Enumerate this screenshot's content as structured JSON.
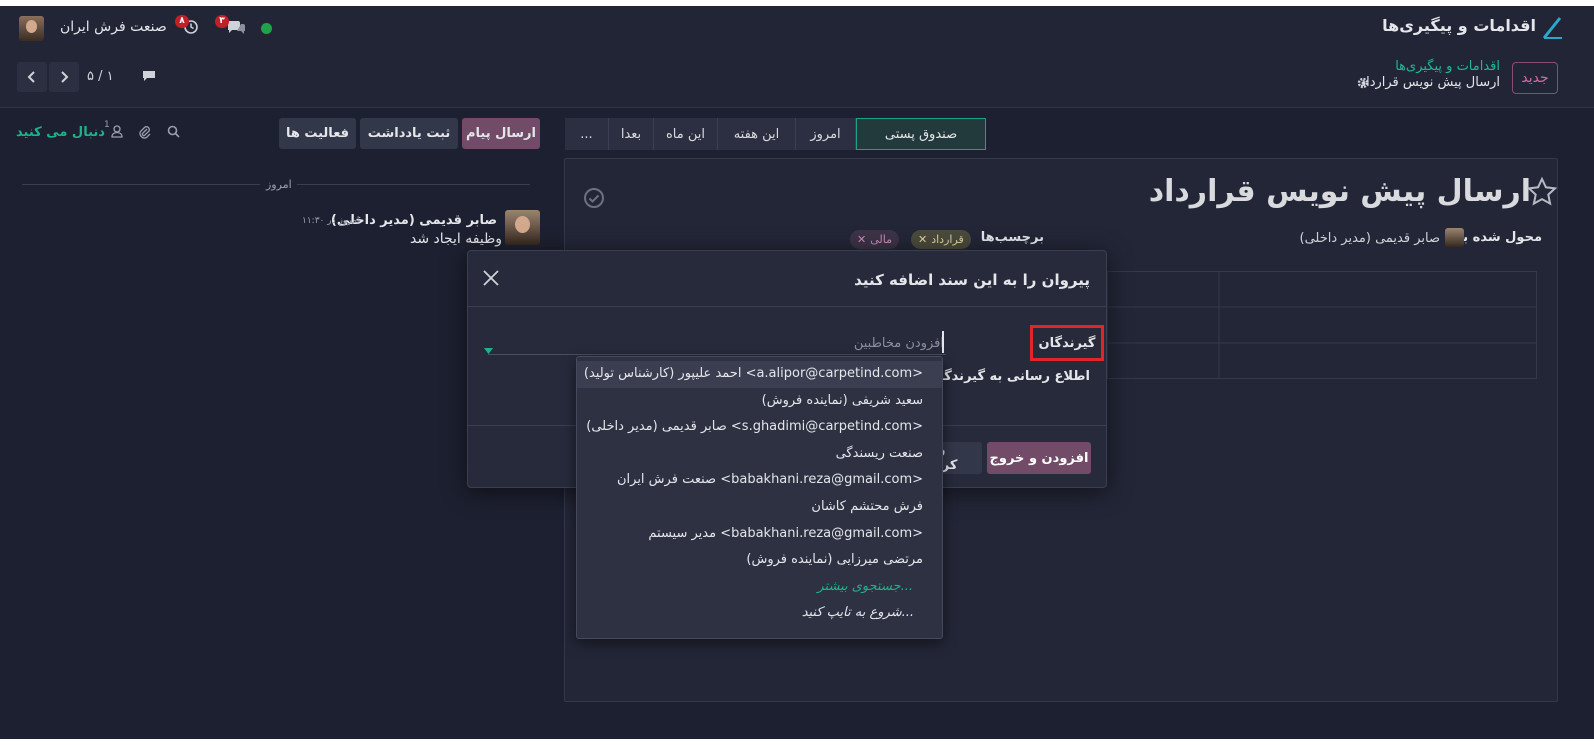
{
  "navbar": {
    "app_title": "اقدامات و پیگیری‌ها",
    "company": "صنعت فرش ایران",
    "activity_badge": "۸",
    "messages_badge": "۳"
  },
  "control_panel": {
    "new_button": "جدید",
    "breadcrumb_parent": "اقدامات و پیگیری‌ها",
    "breadcrumb_current": "ارسال پیش نویس قرارداد",
    "pager_value": "۵ / ۱"
  },
  "chatter": {
    "send_message": "ارسال پیام",
    "log_note": "ثبت یادداشت",
    "activities": "فعالیت ها",
    "follow": "دنبال می کنید",
    "follower_count": "1",
    "today_label": "امروز",
    "message": {
      "author": "صابر قدیمی (مدیر داخلی)",
      "date": "امروز در ۱۱:۳۰",
      "body": "وظیفه ایجاد شد"
    }
  },
  "statusbar": {
    "stages": [
      "...",
      "بعدا",
      "این ماه",
      "این هفته",
      "امروز",
      "صندوق پستی"
    ],
    "active": "صندوق پستی"
  },
  "form": {
    "title": "ارسال پیش نویس قرارداد",
    "assigned_label": "محول شده به",
    "assigned_value": "صابر قدیمی (مدیر داخلی)",
    "tags_label": "برچسب‌ها",
    "tags": [
      "قرارداد",
      "مالی"
    ]
  },
  "modal": {
    "title": "پیروان را به این سند اضافه کنید",
    "recipients_label": "گیرندگان",
    "recipients_placeholder": "افزودن مخاطبین",
    "notify_label": "اطلاع رسانی به گیرندگان",
    "add_close_button": "افزودن و خروج",
    "discard_button": "رها کردن"
  },
  "dropdown": {
    "items": [
      "احمد علیپور (کارشناس تولید) <a.alipor@carpetind.com>",
      "سعید شریفی (نماینده فروش)",
      "صابر قدیمی (مدیر داخلی) <s.ghadimi@carpetind.com>",
      "صنعت ریسندگی",
      "صنعت فرش ایران <babakhani.reza@gmail.com>",
      "فرش محتشم کاشان",
      "مدیر سیستم <babakhani.reza@gmail.com>",
      "مرتضی میرزایی (نماینده فروش)"
    ],
    "search_more": "جستجوی بیشتر...",
    "start_typing": "شروع به تایپ کنید..."
  },
  "colors": {
    "background": "#1d2030",
    "primary": "#714b67",
    "accent": "#1fb28a",
    "highlight_border": "#e0262b"
  }
}
